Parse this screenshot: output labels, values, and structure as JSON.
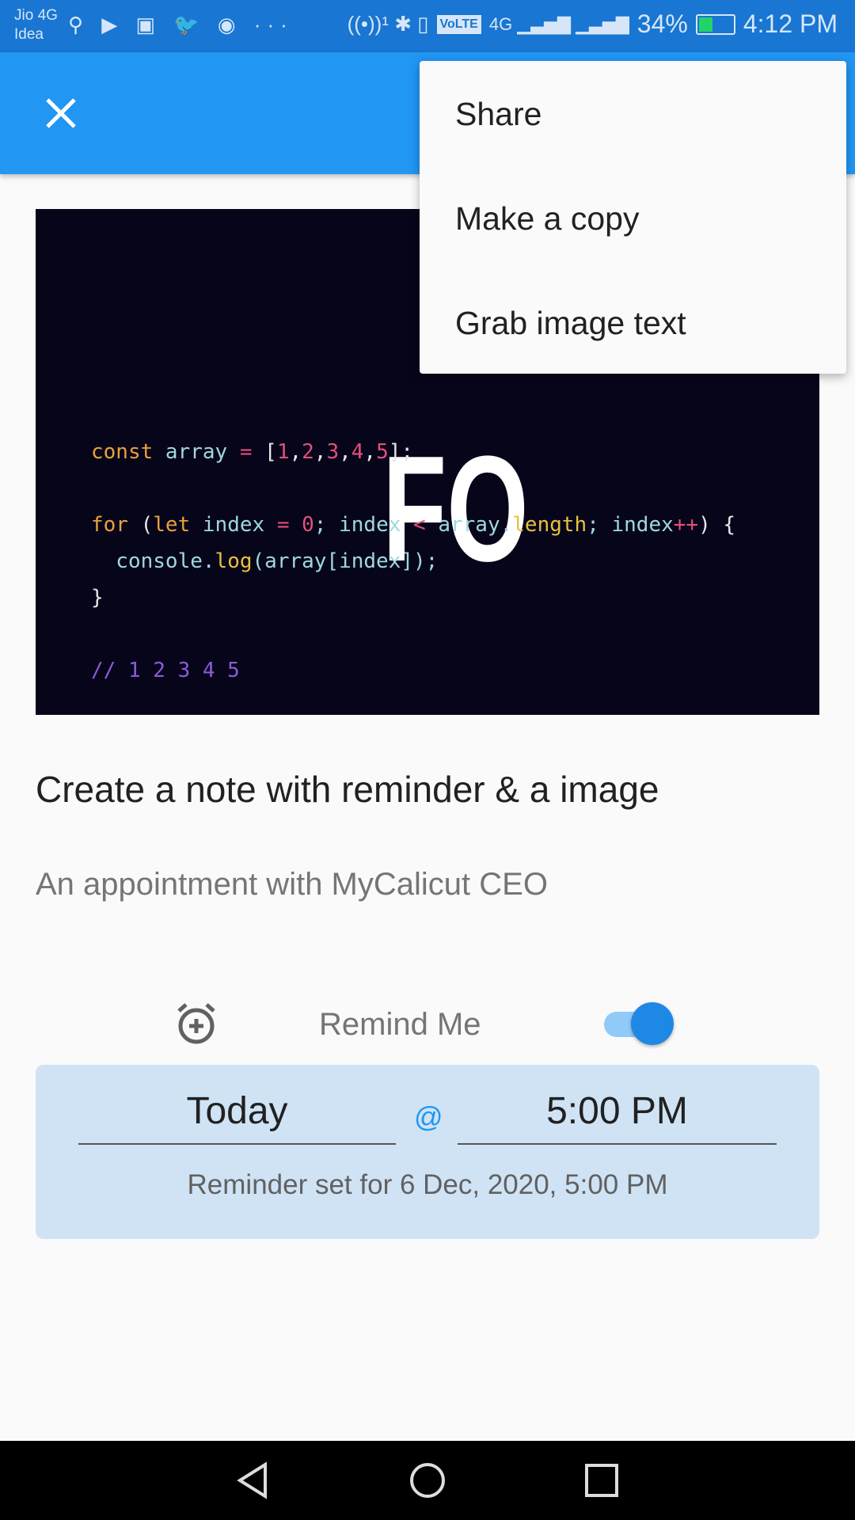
{
  "status_bar": {
    "carrier1": "Jio 4G",
    "carrier2": "Idea",
    "battery": "34%",
    "time": "4:12 PM",
    "icons": [
      "usb-icon",
      "play-icon",
      "tv-icon",
      "twitter-icon",
      "jio-icon",
      "more-icon",
      "hotspot-icon",
      "bluetooth-icon",
      "volte-icon",
      "signal-icon"
    ]
  },
  "menu": {
    "items": [
      "Share",
      "Make a copy",
      "Grab image text"
    ]
  },
  "image": {
    "heading": "FO",
    "code": {
      "l1a": "const",
      "l1b": " array ",
      "l1c": "=",
      "l1d": " [",
      "l1e": "1",
      "l1f": ",",
      "l1g": "2",
      "l1h": ",",
      "l1i": "3",
      "l1j": ",",
      "l1k": "4",
      "l1l": ",",
      "l1m": "5",
      "l1n": "];",
      "l2a": "for",
      "l2b": " (",
      "l2c": "let",
      "l2d": " index ",
      "l2e": "=",
      "l2f": " ",
      "l2g": "0",
      "l2h": "; index ",
      "l2i": "<",
      "l2j": " array.",
      "l2k": "length",
      "l2l": "; index",
      "l2m": "++",
      "l2n": ") {",
      "l3a": "  console.",
      "l3b": "log",
      "l3c": "(array[index]);",
      "l4": "}",
      "l5": "// 1 2 3 4 5"
    }
  },
  "note": {
    "title": "Create a note with reminder & a image",
    "body": "An appointment with MyCalicut CEO"
  },
  "reminder": {
    "label": "Remind Me",
    "enabled": true,
    "date": "Today",
    "at": "@",
    "time": "5:00 PM",
    "summary": "Reminder set for 6 Dec, 2020, 5:00 PM"
  },
  "colors": {
    "appbar": "#2196f3",
    "status": "#1976d2",
    "accent": "#1e88e5",
    "reminder_bg": "#cfe3f5"
  }
}
